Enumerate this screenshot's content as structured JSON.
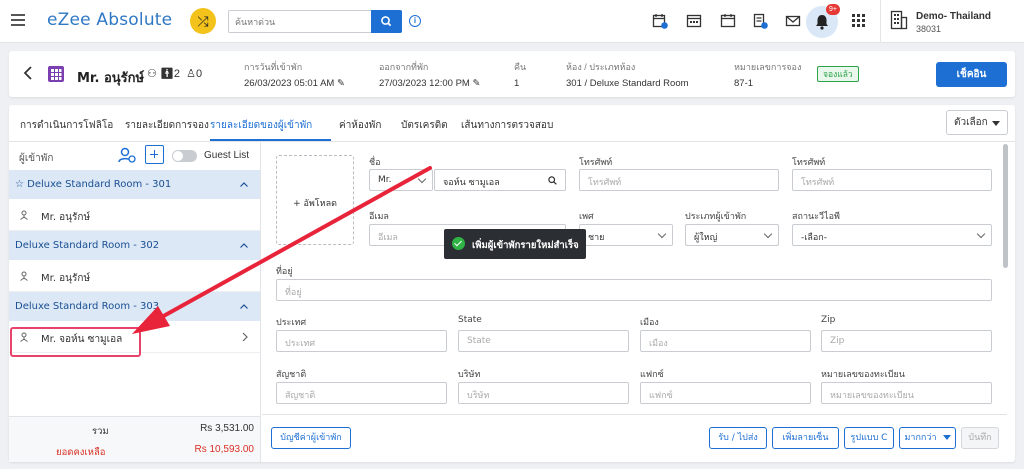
{
  "topbar": {
    "app_name": "eZee Absolute",
    "search_placeholder": "ค้นหาด่วน",
    "notification_badge": "9+",
    "property_name": "Demo- Thailand",
    "property_id": "38031"
  },
  "reservation": {
    "guest_name": "Mr. อนุรักษ์",
    "adults": "2",
    "children": "0",
    "arrival_label": "การวันที่เข้าพัก",
    "arrival_value": "26/03/2023 05:01 AM",
    "departure_label": "ออกจากที่พัก",
    "departure_value": "27/03/2023 12:00 PM",
    "nights_label": "คืน",
    "nights_value": "1",
    "room_label": "ห้อง / ประเภทห้อง",
    "room_value": "301 / Deluxe Standard Room",
    "resno_label": "หมายเลขการจอง",
    "resno_value": "87-1",
    "status": "จองแล้ว",
    "checkin_button": "เช็คอิน"
  },
  "tabs": [
    {
      "label": "การดำเนินการโฟลิโอ"
    },
    {
      "label": "รายละเอียดการจอง"
    },
    {
      "label": "รายละเอียดของผู้เข้าพัก"
    },
    {
      "label": "ค่าห้องพัก"
    },
    {
      "label": "บัตรเครดิต"
    },
    {
      "label": "เส้นทางการตรวจสอบ"
    }
  ],
  "options_button": "ตัวเลือก",
  "guest_panel": {
    "title": "ผู้เข้าพัก",
    "toggle_label": "Guest List",
    "rooms": [
      {
        "name": "Deluxe Standard Room - 301",
        "guest": "Mr. อนุรักษ์"
      },
      {
        "name": "Deluxe Standard Room - 302",
        "guest": "Mr. อนุรักษ์"
      },
      {
        "name": "Deluxe Standard Room - 303",
        "guest": "Mr. จอห์น ซามูเอล"
      }
    ],
    "total_label": "รวม",
    "total_value": "Rs 3,531.00",
    "balance_label": "ยอดคงเหลือ",
    "balance_value": "Rs 10,593.00"
  },
  "form": {
    "upload_label": "+ อัพโหลด",
    "name_label": "ชื่อ",
    "title_value": "Mr.",
    "name_value": "จอห์น ซามูเอล",
    "phone_label": "โทรศัพท์",
    "phone_placeholder": "โทรศัพท์",
    "mobile_label": "โทรศัพท์",
    "mobile_placeholder": "โทรศัพท์",
    "email_label": "อีเมล",
    "email_placeholder": "อีเมล",
    "gender_label": "เพศ",
    "gender_value": "ชาย",
    "guest_type_label": "ประเภทผู้เข้าพัก",
    "guest_type_value": "ผู้ใหญ่",
    "vip_label": "สถานะวีไอพี",
    "vip_value": "-เลือก-",
    "address_label": "ที่อยู่",
    "address_placeholder": "ที่อยู่",
    "country_label": "ประเทศ",
    "country_placeholder": "ประเทศ",
    "state_label": "State",
    "state_placeholder": "State",
    "city_label": "เมือง",
    "city_placeholder": "เมือง",
    "zip_label": "Zip",
    "zip_placeholder": "Zip",
    "nationality_label": "สัญชาติ",
    "nationality_placeholder": "สัญชาติ",
    "company_label": "บริษัท",
    "company_placeholder": "บริษัท",
    "fax_label": "แฟกซ์",
    "fax_placeholder": "แฟกซ์",
    "regno_label": "หมายเลขของทะเบียน",
    "regno_placeholder": "หมายเลขของทะเบียน"
  },
  "toast": "เพิ่มผู้เข้าพักรายใหม่สำเร็จ",
  "buttons": {
    "guest_ledger": "บัญชีค่าผู้เข้าพัก",
    "pickup_drop": "รับ / ไปส่ง",
    "add_signature": "เพิ่มลายเซ็น",
    "form_c": "รูปแบบ C",
    "more": "มากกว่า",
    "save": "บันทึก"
  },
  "colors": {
    "primary": "#1d6fd4",
    "room_header_bg": "#dce8f6",
    "status_green": "#2fa34a",
    "balance_red": "#d93025",
    "annotation_red": "#e8436b"
  }
}
